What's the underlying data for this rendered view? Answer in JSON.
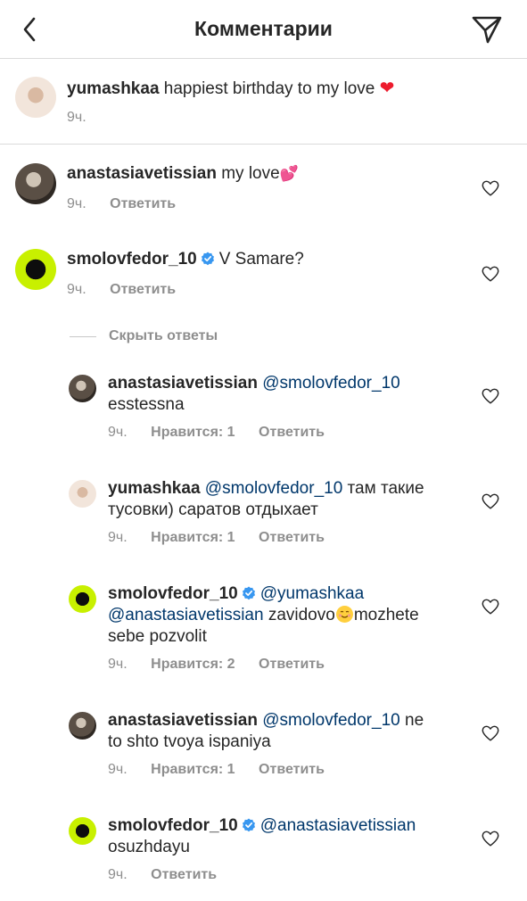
{
  "header": {
    "title": "Комментарии"
  },
  "caption": {
    "username": "yumashkaa",
    "text": "happiest birthday to my love ",
    "emoji": "❤",
    "time": "9ч."
  },
  "comments": [
    {
      "username": "anastasiavetissian",
      "text": "my love",
      "emoji": "💕",
      "time": "9ч.",
      "reply_label": "Ответить"
    },
    {
      "username": "smolovfedor_10",
      "text": "V Samare?",
      "time": "9ч.",
      "reply_label": "Ответить"
    }
  ],
  "hide_replies_label": "Скрыть ответы",
  "replies": [
    {
      "username": "anastasiavetissian",
      "mention": "@smolovfedor_10",
      "line2": "esstessna",
      "time": "9ч.",
      "likes_label": "Нравится: 1",
      "reply_label": "Ответить"
    },
    {
      "username": "yumashkaa",
      "mention": "@smolovfedor_10",
      "line1_rest": " там такие",
      "line2": "тусовки) саратов отдыхает",
      "time": "9ч.",
      "likes_label": "Нравится: 1",
      "reply_label": "Ответить"
    },
    {
      "username": "smolovfedor_10",
      "mention": "@yumashkaa",
      "line2_mention": "@anastasiavetissian",
      "line2_rest_a": " zavidovo",
      "line2_rest_b": "mozhete",
      "line3": "sebe pozvolit",
      "time": "9ч.",
      "likes_label": "Нравится: 2",
      "reply_label": "Ответить"
    },
    {
      "username": "anastasiavetissian",
      "mention": "@smolovfedor_10",
      "line1_rest": " ne",
      "line2": "to shto tvoya ispaniya",
      "time": "9ч.",
      "likes_label": "Нравится: 1",
      "reply_label": "Ответить"
    },
    {
      "username": "smolovfedor_10",
      "mention": "@anastasiavetissian",
      "line2": "osuzhdayu",
      "time": "9ч.",
      "reply_label": "Ответить"
    }
  ],
  "icons": {
    "back": "chevron-left-icon",
    "send": "paper-plane-icon",
    "like": "heart-outline-icon",
    "verified": "verified-badge-icon"
  },
  "colors": {
    "mention": "#00376b",
    "verified": "#3897f0",
    "secondary": "#8e8e8e",
    "divider": "#dbdbdb"
  }
}
